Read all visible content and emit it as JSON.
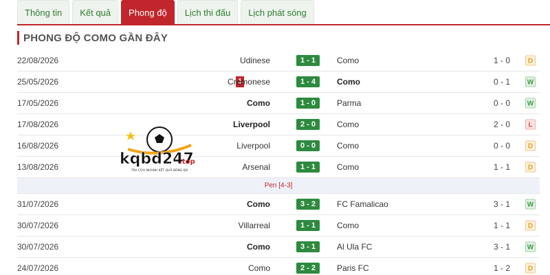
{
  "tabs": [
    {
      "label": "Thông tin",
      "active": false
    },
    {
      "label": "Kết quả",
      "active": false
    },
    {
      "label": "Phong độ",
      "active": true
    },
    {
      "label": "Lịch thi đấu",
      "active": false
    },
    {
      "label": "Lịch phát sóng",
      "active": false
    }
  ],
  "section_title": "PHONG ĐỘ COMO GẦN ĐÂY",
  "matches": [
    {
      "date": "22/08/2026",
      "home": "Udinese",
      "score": "1 - 1",
      "away": "Como",
      "ht": "1 - 0",
      "result": "D"
    },
    {
      "date": "25/05/2026",
      "home": "Cremonese",
      "score": "1 - 4",
      "away": "Como",
      "ht": "0 - 1",
      "result": "W",
      "red_card": "1"
    },
    {
      "date": "17/05/2026",
      "home": "Como",
      "score": "1 - 0",
      "away": "Parma",
      "ht": "0 - 0",
      "result": "W"
    },
    {
      "date": "17/08/2026",
      "home": "Liverpool",
      "score": "2 - 0",
      "away": "Como",
      "ht": "2 - 0",
      "result": "L"
    },
    {
      "date": "16/08/2026",
      "home": "Liverpool",
      "score": "0 - 0",
      "away": "Como",
      "ht": "0 - 0",
      "result": "D"
    },
    {
      "date": "13/08/2026",
      "home": "Arsenal",
      "score": "1 - 1",
      "away": "Como",
      "ht": "1 - 1",
      "result": "D"
    },
    {
      "date": "31/07/2026",
      "home": "Como",
      "score": "3 - 2",
      "away": "FC Famalicao",
      "ht": "3 - 1",
      "result": "W"
    },
    {
      "date": "30/07/2026",
      "home": "Villarreal",
      "score": "1 - 1",
      "away": "Como",
      "ht": "1 - 1",
      "result": "D"
    },
    {
      "date": "30/07/2026",
      "home": "Como",
      "score": "3 - 1",
      "away": "Al Ula FC",
      "ht": "3 - 1",
      "result": "W"
    },
    {
      "date": "24/07/2026",
      "home": "Como",
      "score": "2 - 2",
      "away": "Paris FC",
      "ht": "1 - 2",
      "result": "D"
    }
  ],
  "penalty_note": "Pen [4-3]",
  "watermark": {
    "brand": "kqbd247",
    "suffix": ".top",
    "tagline": "TRA CỨU NHANH KẾT QUẢ BÓNG ĐÁ"
  },
  "colors": {
    "accent": "#c0262c",
    "score_bg": "#2d8a3e",
    "win": "#3f9b4a",
    "draw": "#e0a030",
    "loss": "#d9534f"
  }
}
